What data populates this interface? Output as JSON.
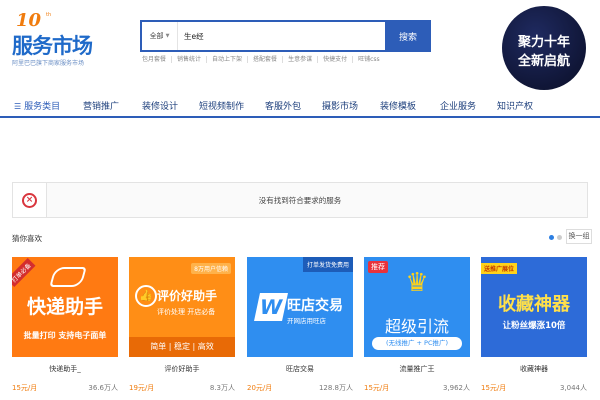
{
  "header": {
    "logo": {
      "number": "10",
      "sup": "th",
      "name": "服务市场",
      "tagline": "阿里巴巴旗下商家服务市场"
    },
    "search": {
      "category": "全部",
      "query": "生e经",
      "button": "搜索",
      "hotwords": [
        "包月套餐",
        "销售统计",
        "自动上下架",
        "搭配套餐",
        "生意参谋",
        "快捷支付",
        "旺铺css"
      ]
    },
    "banner": {
      "line1": "聚力十年",
      "line2": "全新启航"
    }
  },
  "nav": {
    "items": [
      "服务类目",
      "营销推广",
      "装修设计",
      "短视频制作",
      "客服外包",
      "摄影市场",
      "装修模板",
      "企业服务",
      "知识产权"
    ]
  },
  "notice": {
    "text": "没有找到符合要求的服务"
  },
  "recommend": {
    "title": "猜你喜欢",
    "swap": "换一组",
    "cards": [
      {
        "tag": "打单必备",
        "title": "快递助手",
        "sub": "批量打印 支持电子面单",
        "name": "快递助手_",
        "price": "15元/月",
        "sales": "36.6万人"
      },
      {
        "tag": "8万用户信赖",
        "title": "评价好助手",
        "sub": "评价处理 开店必备",
        "extra": "简单 | 稳定 | 高效",
        "name": "评价好助手",
        "price": "19元/月",
        "sales": "8.3万人"
      },
      {
        "tag": "打单发货免费用",
        "title": "旺店交易",
        "sub": "开网店用旺店",
        "name": "旺店交易",
        "price": "20元/月",
        "sales": "128.8万人"
      },
      {
        "tag": "推荐",
        "title": "超级引流",
        "sub": "(无线推广 + PC推广)",
        "name": "流量推广王",
        "price": "15元/月",
        "sales": "3,962人"
      },
      {
        "tag": "送推广展位",
        "title": "收藏神器",
        "sub": "让粉丝爆涨10倍",
        "name": "收藏神器",
        "price": "15元/月",
        "sales": "3,044人"
      }
    ]
  }
}
